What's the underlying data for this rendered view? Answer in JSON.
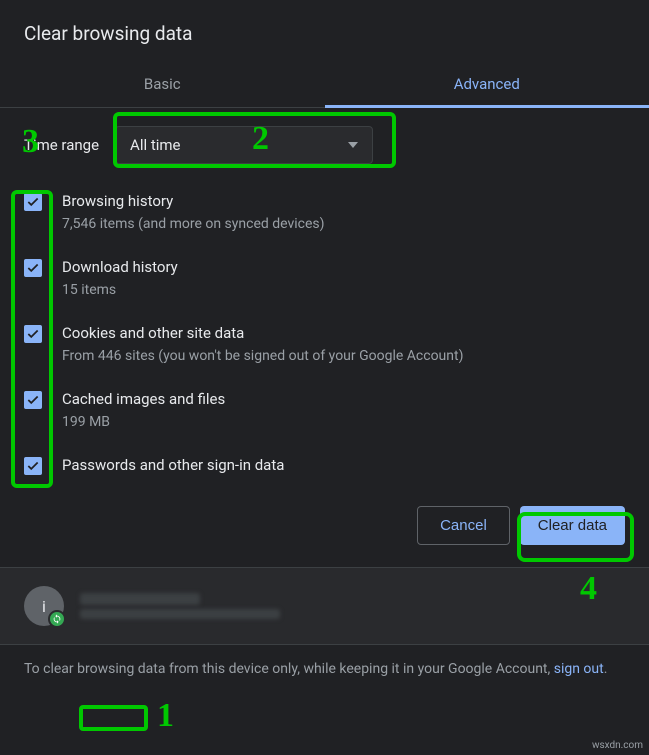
{
  "dialog": {
    "title": "Clear browsing data",
    "tabs": {
      "basic": "Basic",
      "advanced": "Advanced"
    },
    "range_label": "Time range",
    "range_value": "All time",
    "options": [
      {
        "title": "Browsing history",
        "sub": "7,546 items (and more on synced devices)"
      },
      {
        "title": "Download history",
        "sub": "15 items"
      },
      {
        "title": "Cookies and other site data",
        "sub": "From 446 sites (you won't be signed out of your Google Account)"
      },
      {
        "title": "Cached images and files",
        "sub": "199 MB"
      },
      {
        "title": "Passwords and other sign-in data",
        "sub": ""
      }
    ],
    "cancel": "Cancel",
    "clear": "Clear data"
  },
  "account": {
    "avatar_initial": "i"
  },
  "hint": {
    "pre": "To clear browsing data from this device only, while keeping it in your Google Account, ",
    "link": "sign out",
    "post": "."
  },
  "annotations": {
    "n1": "1",
    "n2": "2",
    "n3": "3",
    "n4": "4"
  },
  "watermark": "wsxdn.com"
}
